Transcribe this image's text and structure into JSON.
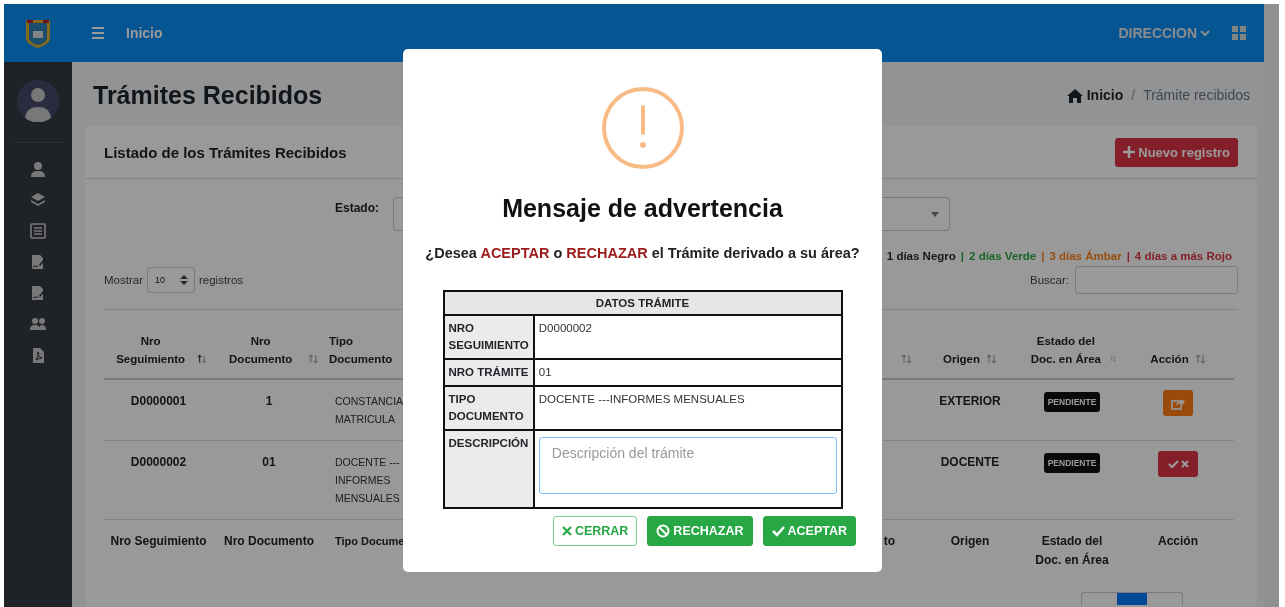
{
  "topbar": {
    "menu_label": "Inicio",
    "user_menu": "DIRECCION"
  },
  "page": {
    "title": "Trámites Recibidos",
    "breadcrumb": [
      {
        "label": "Inicio",
        "kind": "home"
      },
      {
        "separator": "/",
        "label": "Trámite recibidos",
        "kind": "current"
      }
    ]
  },
  "card": {
    "title": "Listado de los Trámites Recibidos",
    "new_button": "Nuevo registro",
    "estado_label": "Estado:",
    "legend": [
      {
        "label": "1 días Negro",
        "color": "#141619"
      },
      {
        "separator": "|",
        "label": "2 días Verde",
        "color": "#186429"
      },
      {
        "separator": "|",
        "label": "3 días Ámbar",
        "color": "#984c0c"
      },
      {
        "separator": "|",
        "label": "4 días a más Rojo",
        "color": "#842029"
      }
    ],
    "length_menu": {
      "before": "Mostrar",
      "value": "10",
      "after": "registros"
    },
    "search_label": "Buscar:",
    "columns": [
      {
        "label": "Nro Seguimiento",
        "sorted": true
      },
      {
        "label": "Nro Documento",
        "sorted": false
      },
      {
        "label": "Tipo Documento"
      },
      {
        "sorted": false
      },
      {
        "label": "Origen",
        "sorted": false
      },
      {
        "label": "Estado del Doc. en Área",
        "sorted": false
      },
      {
        "label": "Acción",
        "sorted": false
      }
    ],
    "rows": [
      {
        "nro_seguimiento": "D0000001",
        "nro_documento": "1",
        "tipo_documento": "CONSTANCIA MATRICULA",
        "origen": "EXTERIOR",
        "estado": "PENDIENTE",
        "action": {
          "kind": "derive"
        }
      },
      {
        "nro_seguimiento": "D0000002",
        "nro_documento": "01",
        "tipo_documento": "DOCENTE --- INFORMES MENSUALES",
        "origen": "DOCENTE",
        "estado": "PENDIENTE",
        "action": {
          "kind": "decide"
        }
      }
    ],
    "footer": [
      "Nro Seguimiento",
      "Nro Documento",
      "Tipo Docume",
      "to",
      "Origen",
      "Estado del Doc. en Área",
      "Acción"
    ]
  },
  "modal": {
    "title": "Mensaje de advertencia",
    "question": [
      {
        "text": "¿Desea "
      },
      {
        "text": "ACEPTAR",
        "emphasis": true
      },
      {
        "text": " o "
      },
      {
        "text": "RECHAZAR",
        "emphasis": true
      },
      {
        "text": " el Trámite derivado a su área?"
      }
    ],
    "details": {
      "heading": "DATOS TRÁMITE",
      "rows": [
        {
          "label": "NRO SEGUIMIENTO",
          "value": "D0000002"
        },
        {
          "label": "NRO TRÁMITE",
          "value": "01"
        },
        {
          "label": "TIPO DOCUMENTO",
          "value": "DOCENTE ---INFORMES MENSUALES"
        },
        {
          "label": "DESCRIPCIÓN",
          "kind": "textarea",
          "placeholder": "Descripción del trámite"
        }
      ]
    },
    "buttons": [
      {
        "label": "CERRAR",
        "kind": "close"
      },
      {
        "label": "RECHAZAR",
        "kind": "reject"
      },
      {
        "label": "ACEPTAR",
        "kind": "accept"
      }
    ]
  }
}
